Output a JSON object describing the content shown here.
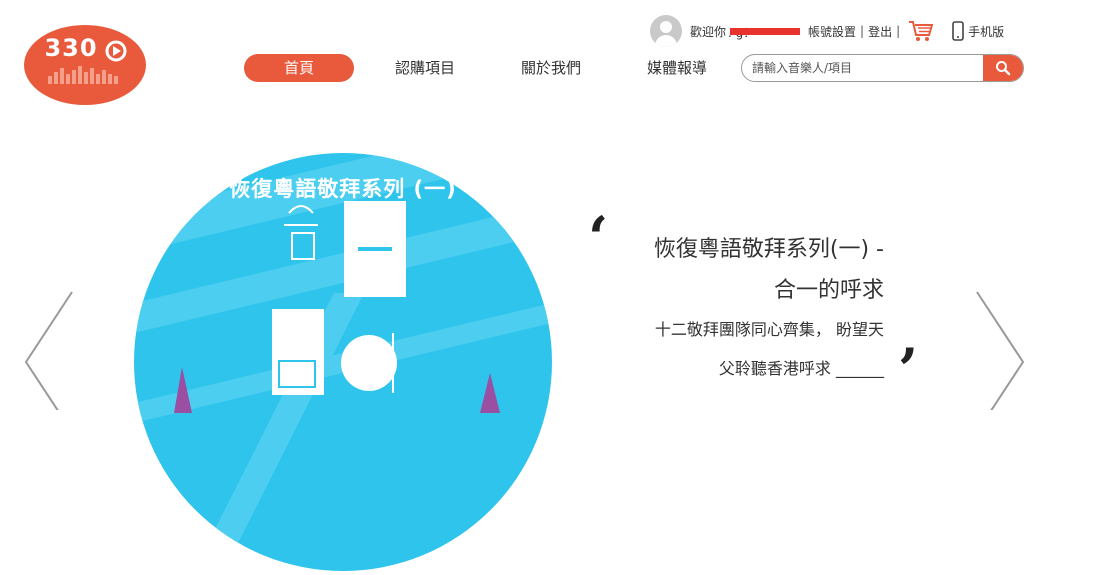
{
  "logo": {
    "text": "330"
  },
  "user_bar": {
    "welcome": "歡迎你",
    "username": ".              g！",
    "account_settings": "帳號設置",
    "separator": "|",
    "logout": "登出"
  },
  "mobile": {
    "label": "手机版"
  },
  "nav": {
    "items": [
      {
        "label": "首頁",
        "active": true
      },
      {
        "label": "認購項目",
        "active": false
      },
      {
        "label": "關於我們",
        "active": false
      },
      {
        "label": "媒體報導",
        "active": false
      }
    ]
  },
  "search": {
    "placeholder": "請輸入音樂人/項目"
  },
  "carousel": {
    "disc_title": "恢復粵語敬拜系列 (一)",
    "title_line1": "恢復粵語敬拜系列(一) -",
    "title_line2": "合一的呼求",
    "desc_line1": "十二敬拜團隊同心齊集， 盼望天",
    "desc_line2": "父聆聽香港呼求 ______",
    "open_quote": "‘",
    "close_quote": "’"
  },
  "colors": {
    "accent": "#e85a3b",
    "disc_blue": "#2ec4ec",
    "redaction": "#e8322e"
  },
  "icons": [
    "logo-icon",
    "avatar-icon",
    "cart-icon",
    "mobile-icon",
    "search-icon",
    "chevron-left-icon",
    "chevron-right-icon"
  ]
}
